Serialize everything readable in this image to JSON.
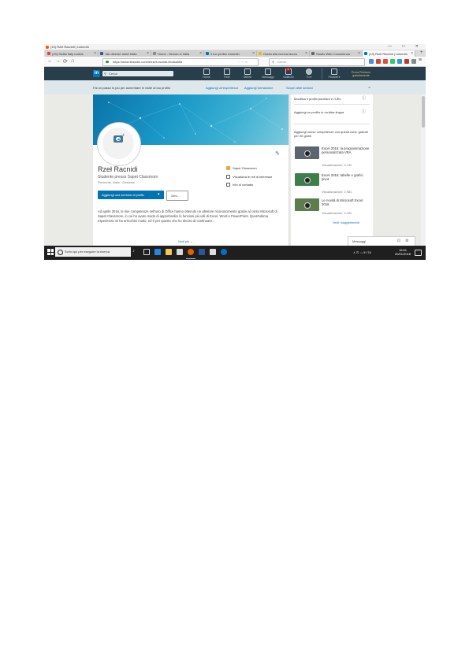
{
  "window": {
    "title": "(13) Rzeł Racnidi | LinkedIn",
    "controls": "— □ ✕"
  },
  "tabs": [
    {
      "label": "(19) Sicilia Italy notizie",
      "color": "#d44"
    },
    {
      "label": "Tab diverse amici Italia",
      "color": "#3b5998"
    },
    {
      "label": "Home - Mondo in Italia",
      "color": "#888"
    },
    {
      "label": "Il tuo profilo Linkedin",
      "color": "#0077b5"
    },
    {
      "label": "Guida alla ricerca lavoro",
      "color": "#f4b400"
    },
    {
      "label": "Studio Web Consulenza",
      "color": "#666"
    },
    {
      "label": "(13) Rzeł Racnidi | LinkedIn",
      "color": "#0077b5",
      "active": true
    }
  ],
  "toolbar": {
    "back": "←",
    "forward": "→",
    "reload": "⟳",
    "home": "⌂",
    "url": "https://www.linkedin.com/in/rzef-racnidi-0b16a86b",
    "menu_dots": "··· ♡ ☆",
    "search_placeholder": "Cerca"
  },
  "linkedin": {
    "logo": "in",
    "search_placeholder": "Cerca",
    "nav": [
      {
        "label": "Home"
      },
      {
        "label": "Rete"
      },
      {
        "label": "Offerte"
      },
      {
        "label": "Messaggi"
      },
      {
        "label": "Notifiche"
      },
      {
        "label": "Tu ▾"
      },
      {
        "label": "Prodotti ▾"
      },
      {
        "label": "Prova Premium gratuitamente"
      }
    ],
    "notifications_count": "1",
    "banner": {
      "message": "Fai un passo in più per aumentare le visite al tuo profilo",
      "links": [
        "Aggiungi un'esperienza",
        "Aggiungi formazione",
        "Scopri altre sezioni"
      ],
      "chevron": "⌄"
    }
  },
  "profile": {
    "name": "Rzeł Racnidi",
    "headline": "Studente presso Sapet Classroom",
    "location": "Piemonte, Italia · Gestione",
    "right_items": [
      {
        "label": "Sapet Classroom",
        "color": "#f7a03c"
      },
      {
        "label": "Visualizza le reti di interesse",
        "color": "#555"
      },
      {
        "label": "Info di contatto",
        "color": "#555"
      }
    ],
    "primary_button": "Aggiungi una sezione al profilo",
    "primary_dropdown": "▾",
    "more_button": "Altro...",
    "edit_icon": "✎",
    "summary": "Ad aprile 2016, le mie competenze nell'uso di Office hanno ottenuto un ulteriore riconoscimento grazie al corso Microsoft di Sapet Classroom, in cui ho avuto modo di approfondire le funzioni più utili di Excel, Word e PowerPoint. Quest'ultima esperienza mi ha arricchito molto, ed è per questo che ho deciso di continuare...",
    "see_more": "Vedi più ⌄"
  },
  "sidebar": {
    "items": [
      {
        "label": "Modifica il profilo pubblico e l'URL",
        "help": "ⓘ"
      },
      {
        "label": "Aggiungi un profilo in un'altra lingua",
        "help": "ⓘ"
      }
    ],
    "learning_title": "Aggiungi nuove competenze con questi corsi, gratuiti per 30 giorni",
    "videos": [
      {
        "title": "Excel 2016: la programmazione personalizzata VBA",
        "views": "Visualizzazioni: 3.740",
        "thumb": "#5c6470"
      },
      {
        "title": "Excel 2016: tabelle e grafici pivot",
        "views": "Visualizzazioni: 2.981",
        "thumb": "#3f7d4a"
      },
      {
        "title": "Le novità di Microsoft Excel 2016",
        "views": "Visualizzazioni: 9.420",
        "thumb": "#5e7d4c"
      }
    ],
    "see_suggestions": "Vedi i suggerimenti",
    "messaging": "Messaggi"
  },
  "taskbar": {
    "search_placeholder": "Scrivi qui per eseguire la ricerca",
    "time": "16:51",
    "date": "20/01/2018",
    "tray": "∧ ⊡ ◅ ≋ ITA",
    "apps": [
      {
        "name": "task-view",
        "color": "#dddddd"
      },
      {
        "name": "edge",
        "color": "#1e88e5"
      },
      {
        "name": "explorer",
        "color": "#f2c94c"
      },
      {
        "name": "store",
        "color": "#d9d9d9"
      },
      {
        "name": "firefox",
        "color": "#e66000"
      },
      {
        "name": "word",
        "color": "#2b579a"
      },
      {
        "name": "mail",
        "color": "#dddddd"
      },
      {
        "name": "outlook",
        "color": "#0072c6"
      }
    ]
  }
}
